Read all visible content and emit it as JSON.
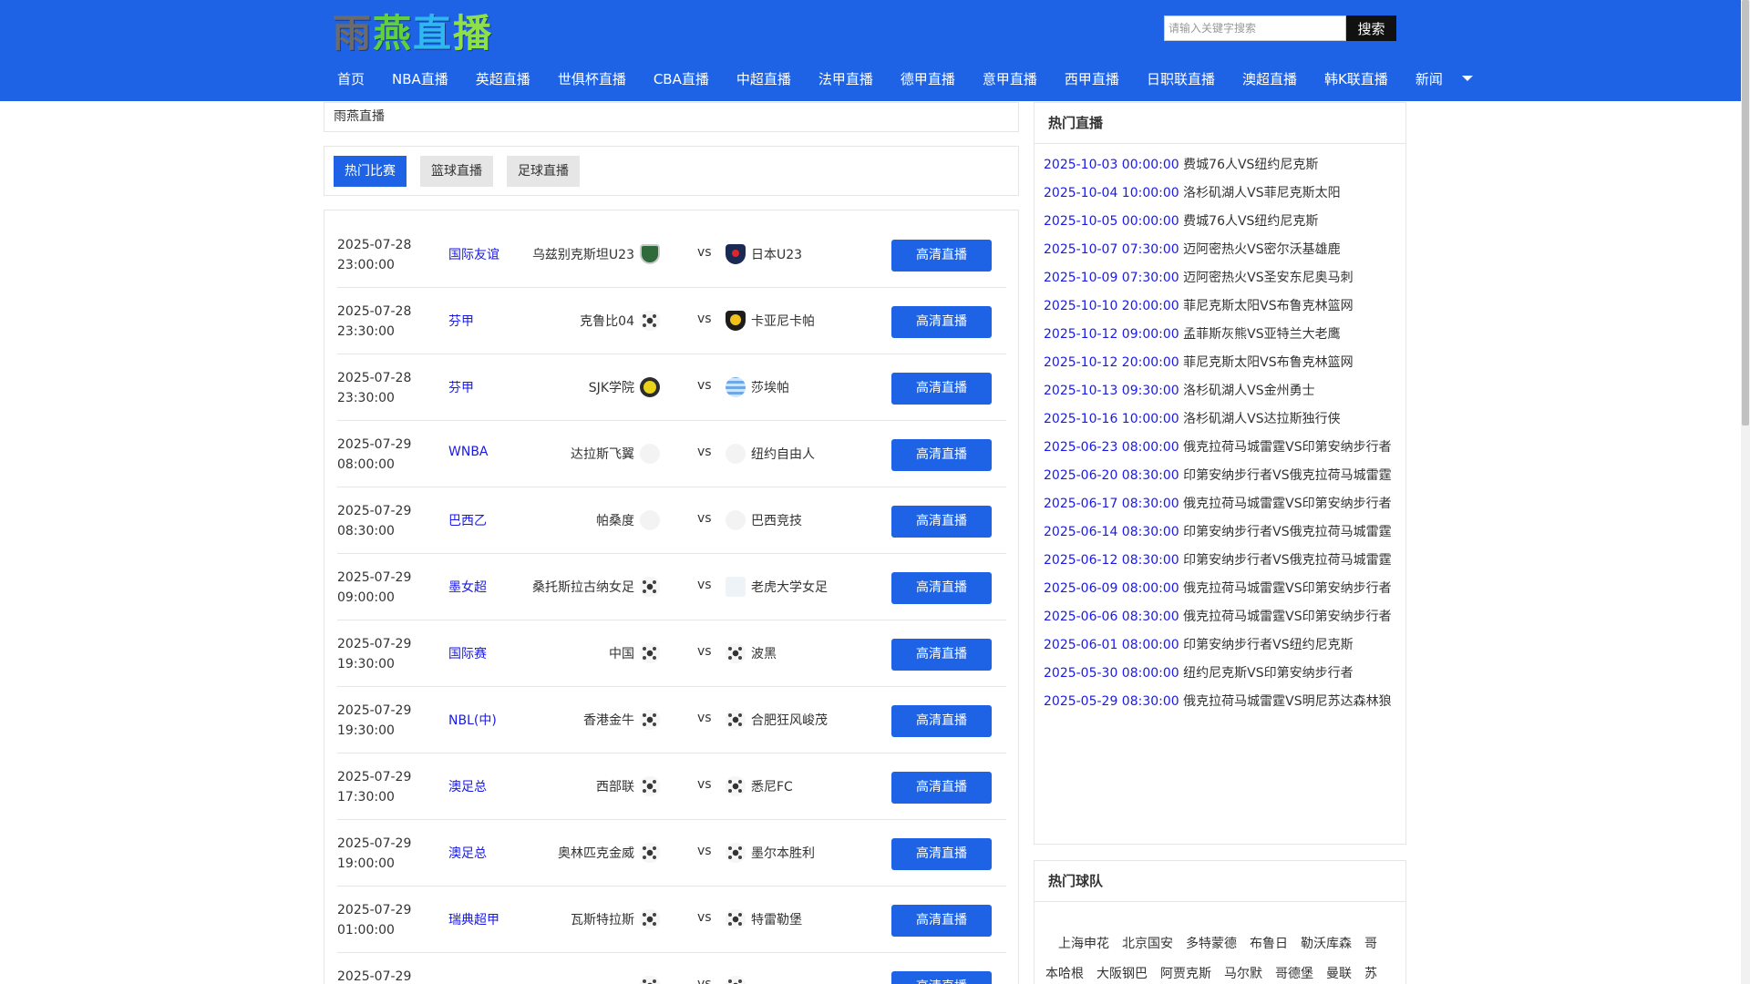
{
  "header": {
    "logo_chars": [
      "雨",
      "燕",
      "直",
      "播"
    ],
    "search_placeholder": "请输入关键字搜索",
    "search_button": "搜索",
    "nav": [
      "首页",
      "NBA直播",
      "英超直播",
      "世俱杯直播",
      "CBA直播",
      "中超直播",
      "法甲直播",
      "德甲直播",
      "意甲直播",
      "西甲直播",
      "日职联直播",
      "澳超直播",
      "韩K联直播",
      "新闻"
    ]
  },
  "breadcrumb": "雨燕直播",
  "tabs": [
    "热门比赛",
    "篮球直播",
    "足球直播"
  ],
  "button_label": "高清直播",
  "vs_label": "vs",
  "matches": [
    {
      "date": "2025-07-28",
      "time": "23:00:00",
      "league": "国际友谊",
      "home": "乌兹别克斯坦U23",
      "home_icon": "uz",
      "away": "日本U23",
      "away_icon": "jp"
    },
    {
      "date": "2025-07-28",
      "time": "23:30:00",
      "league": "芬甲",
      "home": "克鲁比04",
      "home_icon": "ball",
      "away": "卡亚尼卡帕",
      "away_icon": "gold"
    },
    {
      "date": "2025-07-28",
      "time": "23:30:00",
      "league": "芬甲",
      "home": "SJK学院",
      "home_icon": "sjk",
      "away": "莎埃帕",
      "away_icon": "blue"
    },
    {
      "date": "2025-07-29",
      "time": "08:00:00",
      "league": "WNBA",
      "home": "达拉斯飞翼",
      "home_icon": "faint",
      "away": "纽约自由人",
      "away_icon": "faint"
    },
    {
      "date": "2025-07-29",
      "time": "08:30:00",
      "league": "巴西乙",
      "home": "帕桑度",
      "home_icon": "faint",
      "away": "巴西竞技",
      "away_icon": "faint"
    },
    {
      "date": "2025-07-29",
      "time": "09:00:00",
      "league": "墨女超",
      "home": "桑托斯拉古纳女足",
      "home_icon": "ball",
      "away": "老虎大学女足",
      "away_icon": "faint2"
    },
    {
      "date": "2025-07-29",
      "time": "19:30:00",
      "league": "国际赛",
      "home": "中国",
      "home_icon": "ball",
      "away": "波黑",
      "away_icon": "ball"
    },
    {
      "date": "2025-07-29",
      "time": "19:30:00",
      "league": "NBL(中)",
      "home": "香港金牛",
      "home_icon": "ball",
      "away": "合肥狂风峻茂",
      "away_icon": "ball"
    },
    {
      "date": "2025-07-29",
      "time": "17:30:00",
      "league": "澳足总",
      "home": "西部联",
      "home_icon": "ball",
      "away": "悉尼FC",
      "away_icon": "ball"
    },
    {
      "date": "2025-07-29",
      "time": "19:00:00",
      "league": "澳足总",
      "home": "奥林匹克金威",
      "home_icon": "ball",
      "away": "墨尔本胜利",
      "away_icon": "ball"
    },
    {
      "date": "2025-07-29",
      "time": "01:00:00",
      "league": "瑞典超甲",
      "home": "瓦斯特拉斯",
      "home_icon": "ball",
      "away": "特雷勒堡",
      "away_icon": "ball"
    },
    {
      "date": "2025-07-29",
      "time": "",
      "league": "",
      "home": "",
      "home_icon": "ball",
      "away": "",
      "away_icon": "ball"
    }
  ],
  "hot_live": {
    "title": "热门直播",
    "items": [
      {
        "date": "2025-10-03 00:00:00",
        "title": "费城76人VS纽约尼克斯"
      },
      {
        "date": "2025-10-04 10:00:00",
        "title": "洛杉矶湖人VS菲尼克斯太阳"
      },
      {
        "date": "2025-10-05 00:00:00",
        "title": "费城76人VS纽约尼克斯"
      },
      {
        "date": "2025-10-07 07:30:00",
        "title": "迈阿密热火VS密尔沃基雄鹿"
      },
      {
        "date": "2025-10-09 07:30:00",
        "title": "迈阿密热火VS圣安东尼奥马刺"
      },
      {
        "date": "2025-10-10 20:00:00",
        "title": "菲尼克斯太阳VS布鲁克林篮网"
      },
      {
        "date": "2025-10-12 09:00:00",
        "title": "孟菲斯灰熊VS亚特兰大老鹰"
      },
      {
        "date": "2025-10-12 20:00:00",
        "title": "菲尼克斯太阳VS布鲁克林篮网"
      },
      {
        "date": "2025-10-13 09:30:00",
        "title": "洛杉矶湖人VS金州勇士"
      },
      {
        "date": "2025-10-16 10:00:00",
        "title": "洛杉矶湖人VS达拉斯独行侠"
      },
      {
        "date": "2025-06-23 08:00:00",
        "title": "俄克拉荷马城雷霆VS印第安纳步行者"
      },
      {
        "date": "2025-06-20 08:30:00",
        "title": "印第安纳步行者VS俄克拉荷马城雷霆"
      },
      {
        "date": "2025-06-17 08:30:00",
        "title": "俄克拉荷马城雷霆VS印第安纳步行者"
      },
      {
        "date": "2025-06-14 08:30:00",
        "title": "印第安纳步行者VS俄克拉荷马城雷霆"
      },
      {
        "date": "2025-06-12 08:30:00",
        "title": "印第安纳步行者VS俄克拉荷马城雷霆"
      },
      {
        "date": "2025-06-09 08:00:00",
        "title": "俄克拉荷马城雷霆VS印第安纳步行者"
      },
      {
        "date": "2025-06-06 08:30:00",
        "title": "俄克拉荷马城雷霆VS印第安纳步行者"
      },
      {
        "date": "2025-06-01 08:00:00",
        "title": "印第安纳步行者VS纽约尼克斯"
      },
      {
        "date": "2025-05-30 08:00:00",
        "title": "纽约尼克斯VS印第安纳步行者"
      },
      {
        "date": "2025-05-29 08:30:00",
        "title": "俄克拉荷马城雷霆VS明尼苏达森林狼"
      }
    ]
  },
  "hot_teams": {
    "title": "热门球队",
    "line1": [
      "上海申花",
      "北京国安",
      "多特蒙德",
      "布鲁日",
      "勒沃库森",
      "哥"
    ],
    "line2": [
      "本哈根",
      "大阪钢巴",
      "阿贾克斯",
      "马尔默",
      "哥德堡",
      "曼联",
      "苏"
    ]
  },
  "colors": {
    "brand_blue": "#1e63e6",
    "link_blue": "#1a1ae6"
  }
}
